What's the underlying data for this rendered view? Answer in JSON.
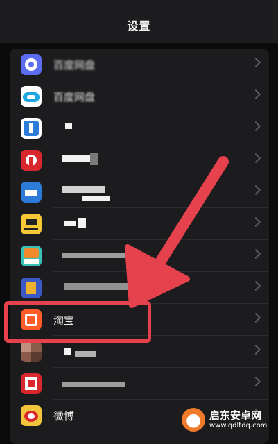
{
  "header": {
    "title": "设置"
  },
  "rows": [
    {
      "label": "百度网盘",
      "icon": "app-icon-baidu-pan"
    },
    {
      "label": "百度网盘",
      "icon": "app-icon-baidu-cloud"
    },
    {
      "label": "",
      "icon": "app-icon-blurred-1"
    },
    {
      "label": "",
      "icon": "app-icon-blurred-2"
    },
    {
      "label": "",
      "icon": "app-icon-blurred-3"
    },
    {
      "label": "",
      "icon": "app-icon-blurred-4"
    },
    {
      "label": "",
      "icon": "app-icon-blurred-5"
    },
    {
      "label": "",
      "icon": "app-icon-blurred-6"
    },
    {
      "label": "淘宝",
      "icon": "app-icon-taobao"
    },
    {
      "label": "",
      "icon": "app-icon-blurred-7"
    },
    {
      "label": "",
      "icon": "app-icon-blurred-8"
    },
    {
      "label": "微博",
      "icon": "app-icon-weibo"
    }
  ],
  "watermark": {
    "name": "启东安卓网",
    "url": "www.qdltdq.com"
  },
  "colors": {
    "highlight": "#e5424d",
    "arrow": "#e5424d"
  }
}
